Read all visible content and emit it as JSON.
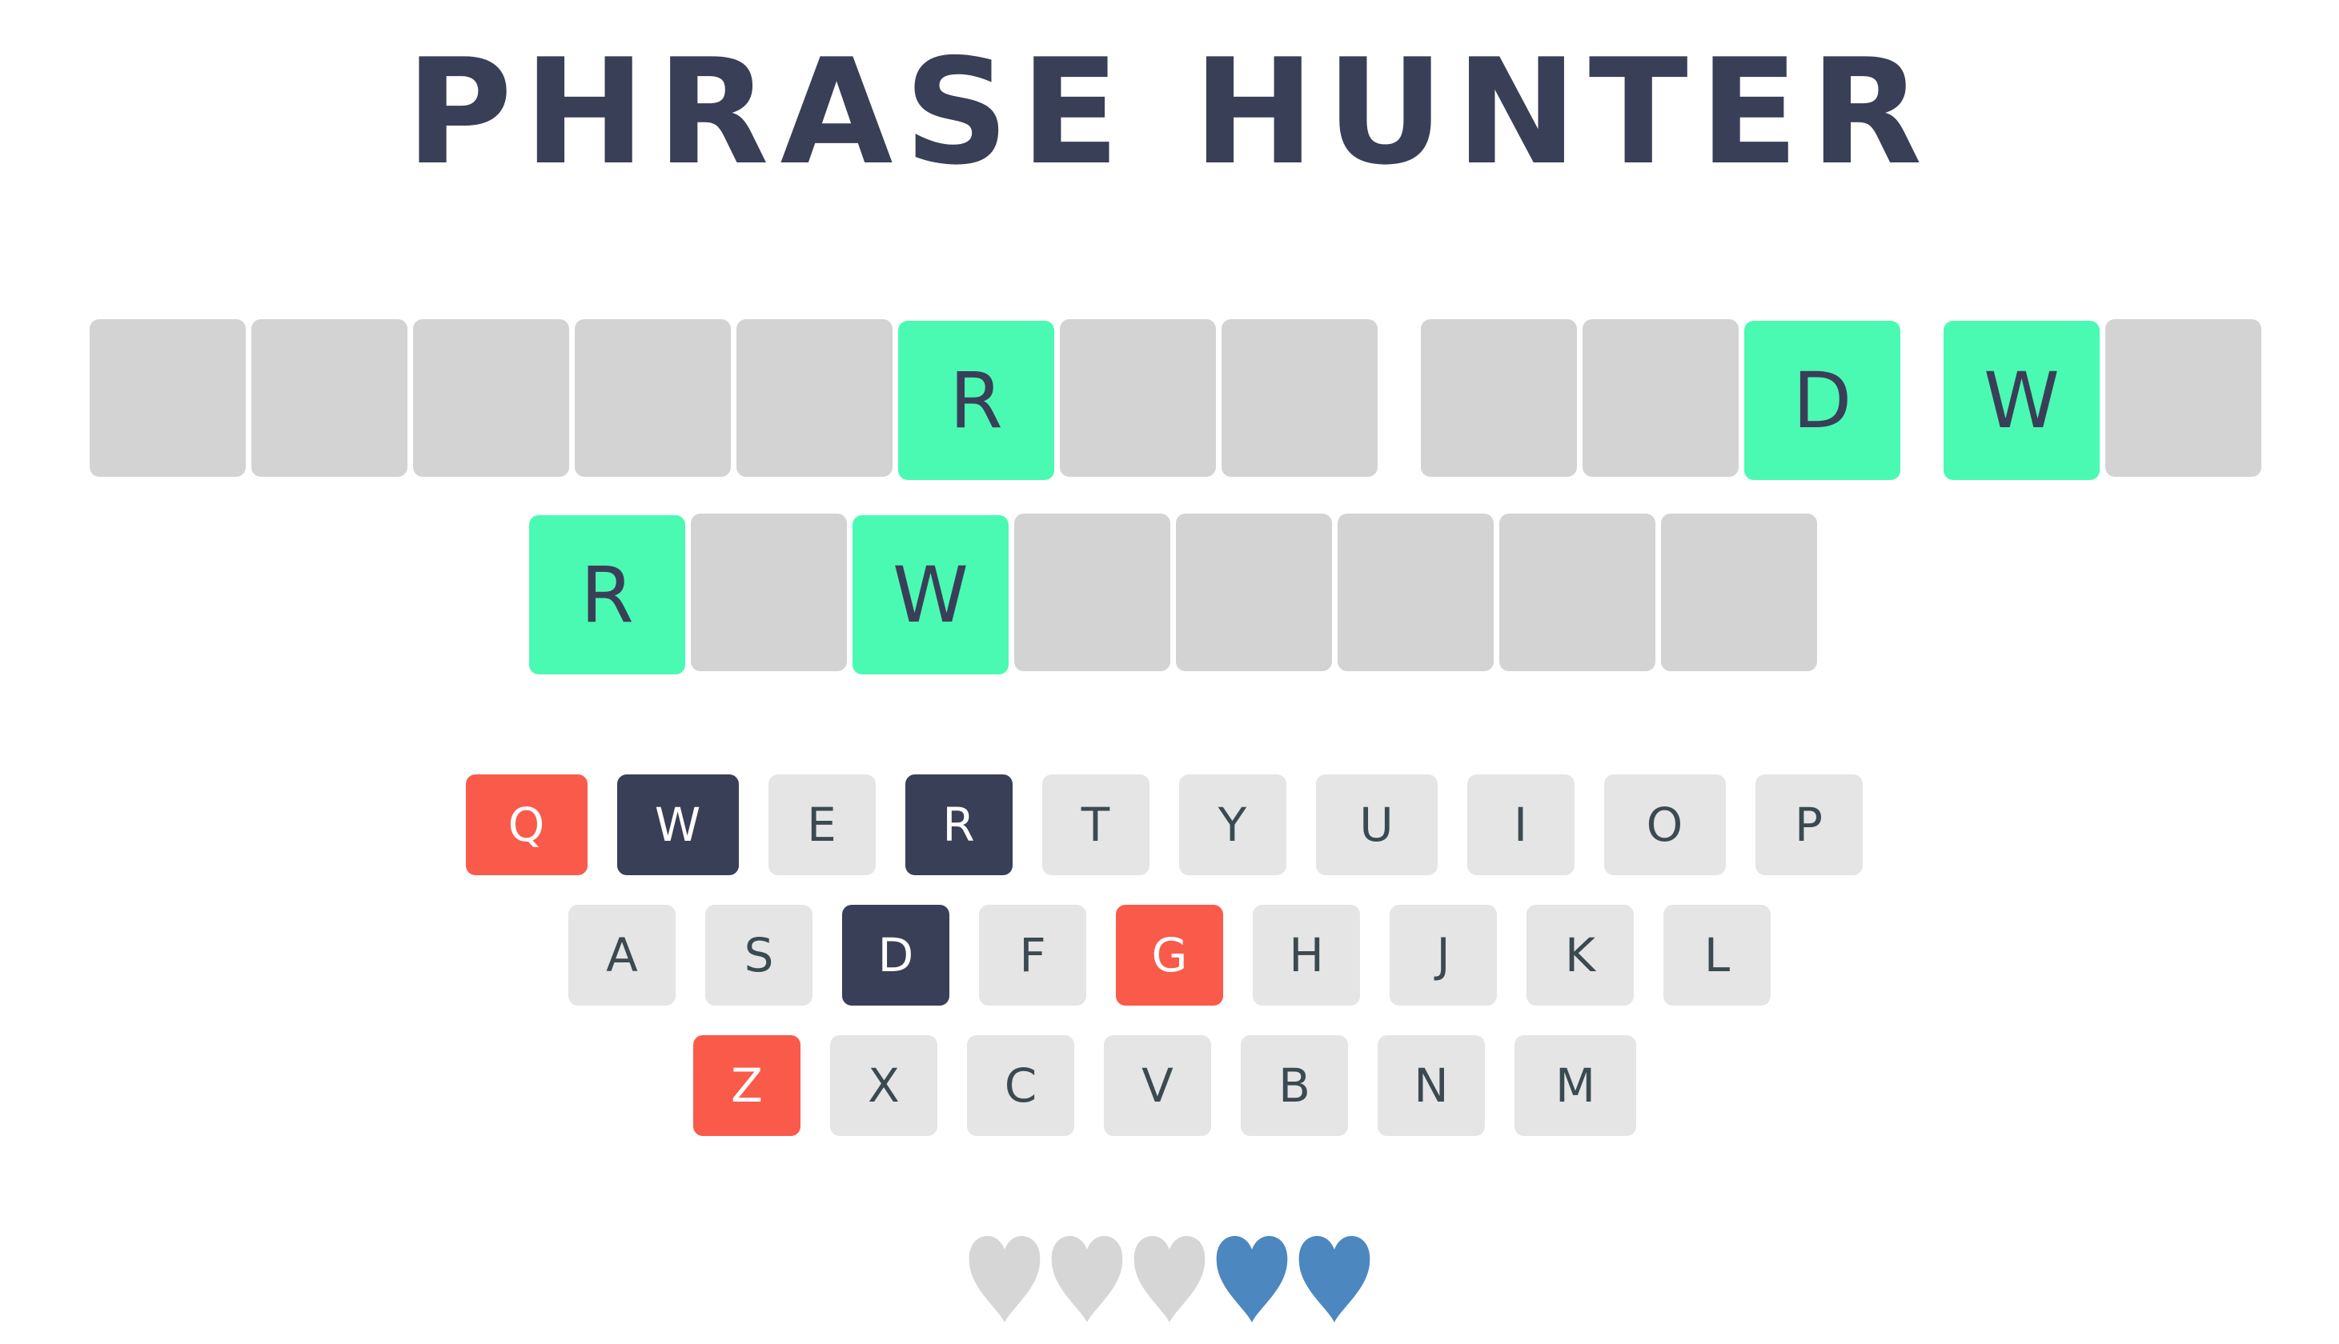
{
  "title": "PHRASE HUNTER",
  "phrase": {
    "rows": [
      [
        [
          null,
          null,
          null,
          null,
          null,
          "R",
          null,
          null
        ],
        [
          null,
          null,
          "D"
        ],
        [
          "W",
          null
        ]
      ],
      [
        [
          "R",
          null,
          "W",
          null,
          null,
          null,
          null,
          null
        ]
      ]
    ]
  },
  "keyboard": {
    "rows": [
      [
        {
          "l": "Q",
          "s": "wrong"
        },
        {
          "l": "W",
          "s": "chosen"
        },
        {
          "l": "E",
          "s": ""
        },
        {
          "l": "R",
          "s": "chosen"
        },
        {
          "l": "T",
          "s": ""
        },
        {
          "l": "Y",
          "s": ""
        },
        {
          "l": "U",
          "s": ""
        },
        {
          "l": "I",
          "s": ""
        },
        {
          "l": "O",
          "s": ""
        },
        {
          "l": "P",
          "s": ""
        }
      ],
      [
        {
          "l": "A",
          "s": ""
        },
        {
          "l": "S",
          "s": ""
        },
        {
          "l": "D",
          "s": "chosen"
        },
        {
          "l": "F",
          "s": ""
        },
        {
          "l": "G",
          "s": "wrong"
        },
        {
          "l": "H",
          "s": ""
        },
        {
          "l": "J",
          "s": ""
        },
        {
          "l": "K",
          "s": ""
        },
        {
          "l": "L",
          "s": ""
        }
      ],
      [
        {
          "l": "Z",
          "s": "wrong"
        },
        {
          "l": "X",
          "s": ""
        },
        {
          "l": "C",
          "s": ""
        },
        {
          "l": "V",
          "s": ""
        },
        {
          "l": "B",
          "s": ""
        },
        {
          "l": "N",
          "s": ""
        },
        {
          "l": "M",
          "s": ""
        }
      ]
    ]
  },
  "lives": {
    "total": 5,
    "remaining": 2,
    "lost_color": "#d6d6d6",
    "live_color": "#4d87c0"
  },
  "colors": {
    "revealed": "#4afab3",
    "hidden": "#d3d3d3",
    "wrong": "#fa5a4a",
    "chosen": "#3a3f58",
    "key": "#e5e5e5"
  }
}
